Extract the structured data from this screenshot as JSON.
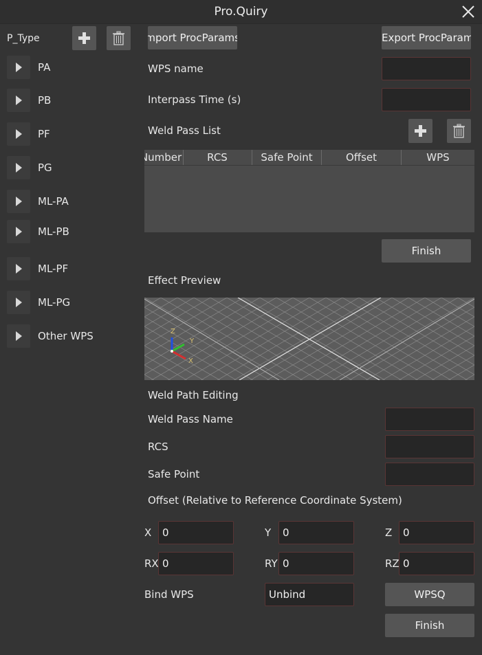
{
  "window": {
    "title": "Pro.Quiry"
  },
  "sidebar": {
    "header_label": "P_Type",
    "items": [
      {
        "label": "PA"
      },
      {
        "label": "PB"
      },
      {
        "label": "PF"
      },
      {
        "label": "PG"
      },
      {
        "label": "ML-PA"
      },
      {
        "label": "ML-PB"
      },
      {
        "label": "ML-PF"
      },
      {
        "label": "ML-PG"
      },
      {
        "label": "Other WPS"
      }
    ]
  },
  "toolbar": {
    "import_label": "Import ProcParams",
    "export_label": "Export ProcParams"
  },
  "wps": {
    "name_label": "WPS name",
    "name_value": "",
    "interpass_label": "Interpass Time (s)",
    "interpass_value": ""
  },
  "weld_pass_list": {
    "title": "Weld Pass List",
    "columns": [
      "Number",
      "RCS",
      "Safe Point",
      "Offset",
      "WPS"
    ],
    "rows": [],
    "finish_label": "Finish"
  },
  "preview": {
    "title": "Effect Preview",
    "axes": {
      "x": "X",
      "y": "Y",
      "z": "Z"
    },
    "colors": {
      "x": "#d03030",
      "y": "#30c030",
      "z": "#2050e0"
    }
  },
  "path_editing": {
    "title": "Weld Path Editing",
    "pass_name_label": "Weld Pass Name",
    "pass_name_value": "",
    "rcs_label": "RCS",
    "rcs_value": "",
    "safe_point_label": "Safe Point",
    "safe_point_value": "",
    "offset_title": "Offset (Relative to Reference Coordinate System)",
    "offset": {
      "x_label": "X",
      "x_value": "0",
      "y_label": "Y",
      "y_value": "0",
      "z_label": "Z",
      "z_value": "0",
      "rx_label": "RX",
      "rx_value": "0",
      "ry_label": "RY",
      "ry_value": "0",
      "rz_label": "RZ",
      "rz_value": "0"
    },
    "bind_label": "Bind WPS",
    "bind_value": "Unbind",
    "wpsq_label": "WPSQ",
    "finish_label": "Finish"
  }
}
